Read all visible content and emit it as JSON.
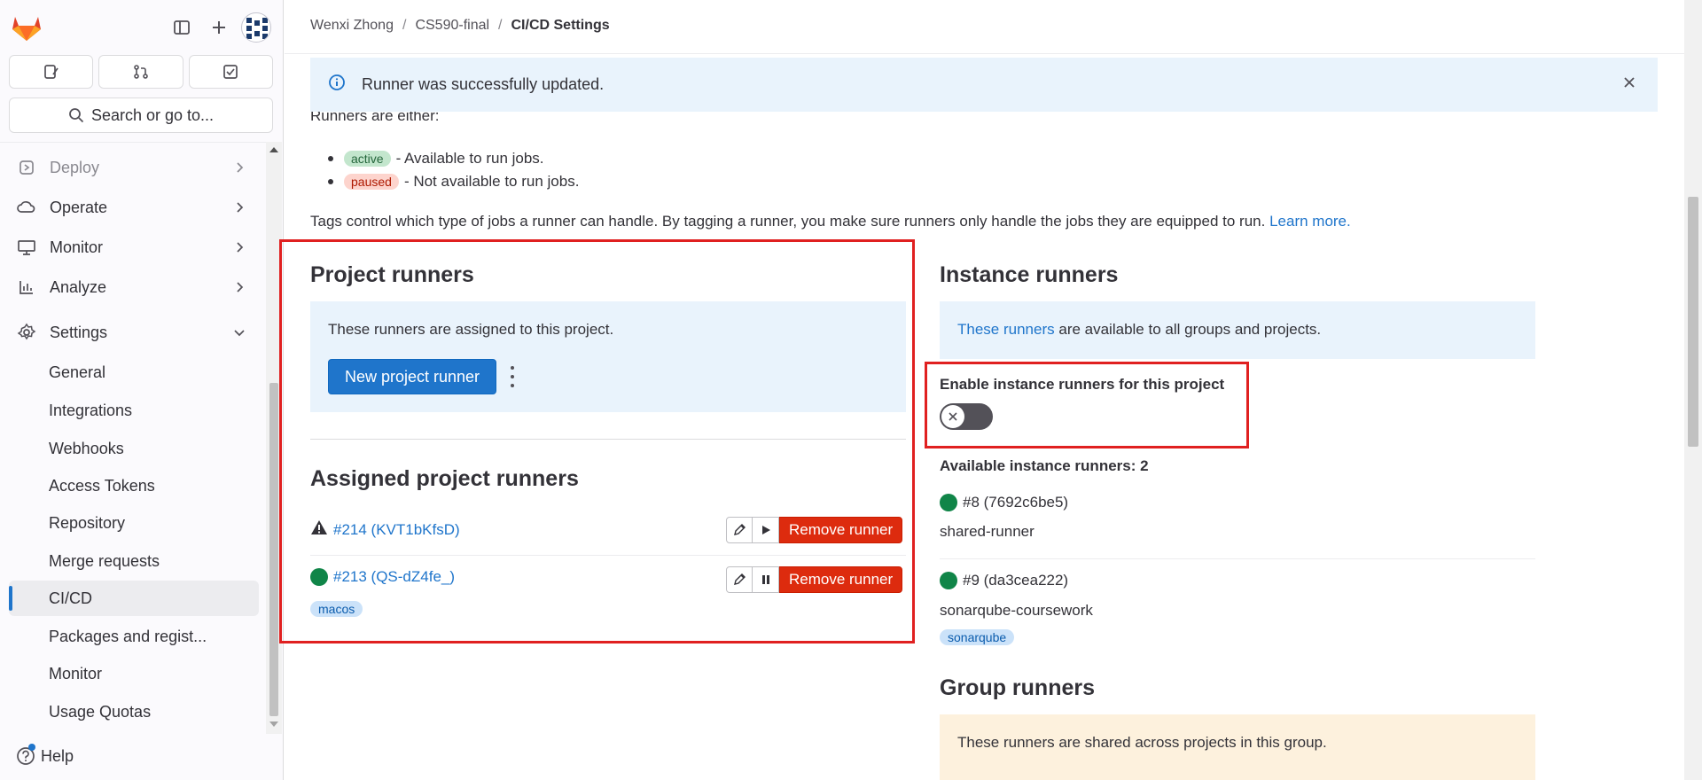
{
  "sidebar": {
    "search_label": "Search or go to...",
    "nav_items": [
      {
        "label": "Deploy",
        "icon": "rocket-icon"
      },
      {
        "label": "Operate",
        "icon": "cloud-gear-icon"
      },
      {
        "label": "Monitor",
        "icon": "monitor-icon"
      },
      {
        "label": "Analyze",
        "icon": "chart-icon"
      },
      {
        "label": "Settings",
        "icon": "gear-icon"
      }
    ],
    "settings_sub": [
      "General",
      "Integrations",
      "Webhooks",
      "Access Tokens",
      "Repository",
      "Merge requests",
      "CI/CD",
      "Packages and regist...",
      "Monitor",
      "Usage Quotas"
    ],
    "active_sub": "CI/CD",
    "help_label": "Help"
  },
  "breadcrumb": [
    "Wenxi Zhong",
    "CS590-final",
    "CI/CD Settings"
  ],
  "alert": {
    "text": "Runner was successfully updated."
  },
  "intro": {
    "heading": "Runners are either:",
    "bullets": [
      {
        "badge": "active",
        "text": "- Available to run jobs."
      },
      {
        "badge": "paused",
        "text": "- Not available to run jobs."
      }
    ],
    "tags_text": "Tags control which type of jobs a runner can handle. By tagging a runner, you make sure runners only handle the jobs they are equipped to run.",
    "learn_more": "Learn more."
  },
  "project_runners": {
    "title": "Project runners",
    "info": "These runners are assigned to this project.",
    "new_button": "New project runner",
    "assigned_title": "Assigned project runners",
    "runners": [
      {
        "name": "#214 (KVT1bKfsD)",
        "status": "warning",
        "action_icon": "play-icon",
        "remove": "Remove runner",
        "tags": []
      },
      {
        "name": "#213 (QS-dZ4fe_)",
        "status": "online",
        "action_icon": "pause-icon",
        "remove": "Remove runner",
        "tags": [
          "macos"
        ]
      }
    ]
  },
  "instance_runners": {
    "title": "Instance runners",
    "info_link": "These runners",
    "info_rest": "are available to all groups and projects.",
    "toggle_label": "Enable instance runners for this project",
    "toggle_on": false,
    "available_label": "Available instance runners: 2",
    "runners": [
      {
        "name": "#8 (7692c6be5)",
        "desc": "shared-runner",
        "tags": []
      },
      {
        "name": "#9 (da3cea222)",
        "desc": "sonarqube-coursework",
        "tags": [
          "sonarqube"
        ]
      }
    ]
  },
  "group_runners": {
    "title": "Group runners",
    "info": "These runners are shared across projects in this group."
  },
  "colors": {
    "accent": "#1f75cb",
    "danger": "#dd2b0e",
    "online": "#108548",
    "highlight": "#e02020"
  }
}
